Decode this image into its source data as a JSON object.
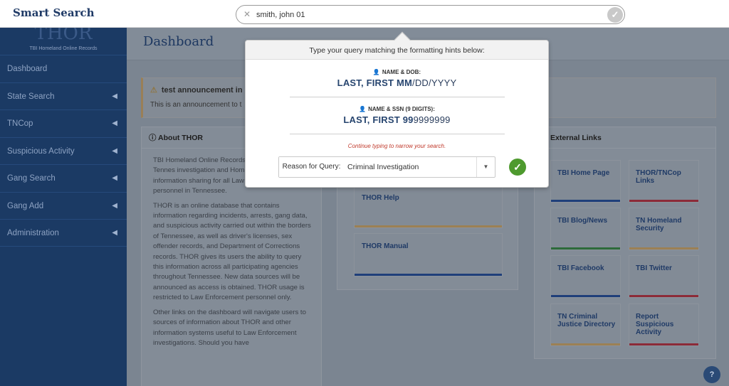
{
  "app": {
    "title": "Smart Search"
  },
  "search": {
    "value": "smith, john 01",
    "clear_icon": "close-icon",
    "submit_icon": "check-icon"
  },
  "sidebar": {
    "logo_text": "THOR",
    "logo_subtitle": "TBI Homeland Online Records",
    "items": [
      {
        "label": "Dashboard",
        "has_submenu": false
      },
      {
        "label": "State Search",
        "has_submenu": true
      },
      {
        "label": "TNCop",
        "has_submenu": true
      },
      {
        "label": "Suspicious Activity",
        "has_submenu": true
      },
      {
        "label": "Gang Search",
        "has_submenu": true
      },
      {
        "label": "Gang Add",
        "has_submenu": true
      },
      {
        "label": "Administration",
        "has_submenu": true
      }
    ]
  },
  "main": {
    "page_title": "Dashboard",
    "announcement": {
      "title": "test announcement in d",
      "body": "This is an announcement to t"
    },
    "about": {
      "title": "About THOR",
      "paragraphs": [
        "TBI Homeland Online Records venture between the Tennes investigation and Homeland fosters information sharing for all Law Enforcement personnel in Tennessee.",
        "THOR is an online database that contains information regarding incidents, arrests, gang data, and suspicious activity carried out within the borders of Tennessee, as well as driver's licenses, sex offender records, and Department of Corrections records. THOR gives its users the ability to query this information across all participating agencies throughout Tennessee. New data sources will be announced as access is obtained. THOR usage is restricted to Law Enforcement personnel only.",
        "Other links on the dashboard will navigate users to sources of information about THOR and other information systems useful to Law Enforcement investigations. Should you have"
      ]
    },
    "resources": [
      {
        "label": "THOR Help",
        "color": "#9c8054"
      },
      {
        "label": "THOR Manual",
        "color": "#1f3f7a"
      }
    ],
    "external_links": {
      "title": "External Links",
      "tiles": [
        {
          "label": "TBI Home Page",
          "color": "#1f3f7a"
        },
        {
          "label": "THOR/TNCop Links",
          "color": "#8c2b38"
        },
        {
          "label": "TBI Blog/News",
          "color": "#2d6b3a"
        },
        {
          "label": "TN Homeland Security",
          "color": "#9c8054"
        },
        {
          "label": "TBI Facebook",
          "color": "#1f3f7a"
        },
        {
          "label": "TBI Twitter",
          "color": "#8c2b38"
        },
        {
          "label": "TN Criminal Justice Directory",
          "color": "#9c8054"
        },
        {
          "label": "Report Suspicious Activity",
          "color": "#8c2b38"
        }
      ]
    }
  },
  "popup": {
    "header": "Type your query matching the formatting hints below:",
    "hint1_label": "NAME & DOB:",
    "hint1_bold": "LAST, FIRST MM",
    "hint1_rest": "/DD/YYYY",
    "hint2_label": "NAME & SSN (9 DIGITS):",
    "hint2_bold": "LAST, FIRST 99",
    "hint2_rest": "9999999",
    "continue_message": "Continue typing to narrow your search.",
    "reason_label": "Reason for Query:",
    "reason_value": "Criminal Investigation"
  },
  "help_button": {
    "label": "?"
  }
}
